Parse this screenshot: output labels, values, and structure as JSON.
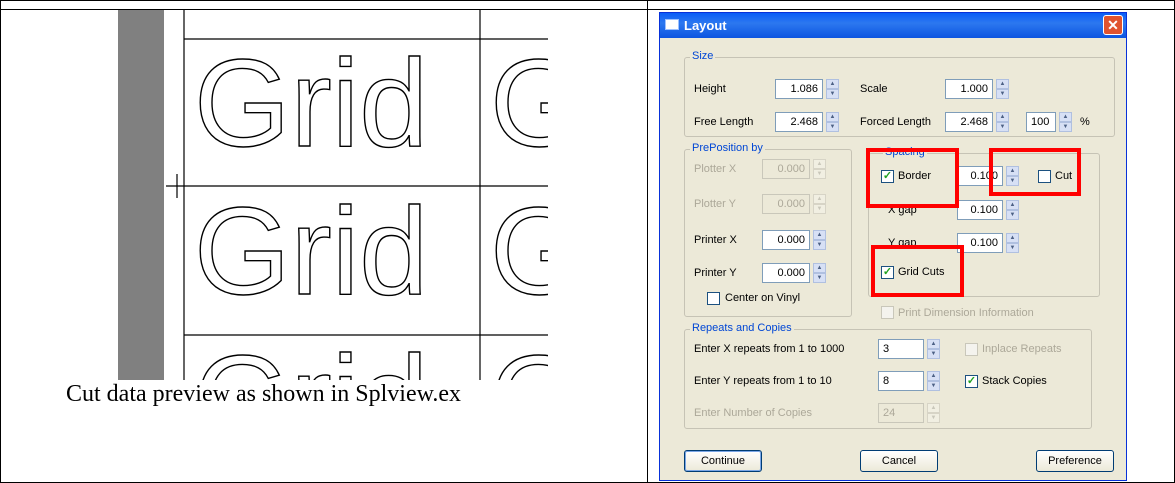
{
  "caption": "Cut data preview as shown in Splview.ex",
  "preview": {
    "word": "Grid"
  },
  "dialog": {
    "title": "Layout",
    "size": {
      "group_label": "Size",
      "height_label": "Height",
      "height_value": "1.086",
      "scale_label": "Scale",
      "scale_value": "1.000",
      "free_length_label": "Free Length",
      "free_length_value": "2.468",
      "forced_length_label": "Forced Length",
      "forced_length_value": "2.468",
      "percent_value": "100",
      "percent_symbol": "%"
    },
    "preposition": {
      "group_label": "PrePosition by",
      "plotter_x_label": "Plotter X",
      "plotter_x_value": "0.000",
      "plotter_y_label": "Plotter Y",
      "plotter_y_value": "0.000",
      "printer_x_label": "Printer X",
      "printer_x_value": "0.000",
      "printer_y_label": "Printer Y",
      "printer_y_value": "0.000",
      "center_on_vinyl_label": "Center on Vinyl"
    },
    "spacing": {
      "group_label": "Spacing",
      "border_label": "Border",
      "border_value": "0.100",
      "cut_label": "Cut",
      "x_gap_label": "X gap",
      "x_gap_value": "0.100",
      "y_gap_label": "Y gap",
      "y_gap_value": "0.100",
      "grid_cuts_label": "Grid Cuts"
    },
    "print_dimension_label": "Print Dimension Information",
    "repeats": {
      "group_label": "Repeats and Copies",
      "x_repeats_label": "Enter X repeats from 1 to 1000",
      "x_repeats_value": "3",
      "y_repeats_label": "Enter Y repeats from 1 to 10",
      "y_repeats_value": "8",
      "copies_label": "Enter Number of Copies",
      "copies_value": "24",
      "inplace_repeats_label": "Inplace Repeats",
      "stack_copies_label": "Stack Copies"
    },
    "buttons": {
      "continue": "Continue",
      "cancel": "Cancel",
      "preference": "Preference"
    },
    "checkmark": "✓",
    "close_glyph": "✕"
  },
  "colors": {
    "highlight": "#ff0000",
    "titlebar": "#0a5df7",
    "group_label": "#0046d5",
    "dialog_bg": "#ece9d8"
  }
}
